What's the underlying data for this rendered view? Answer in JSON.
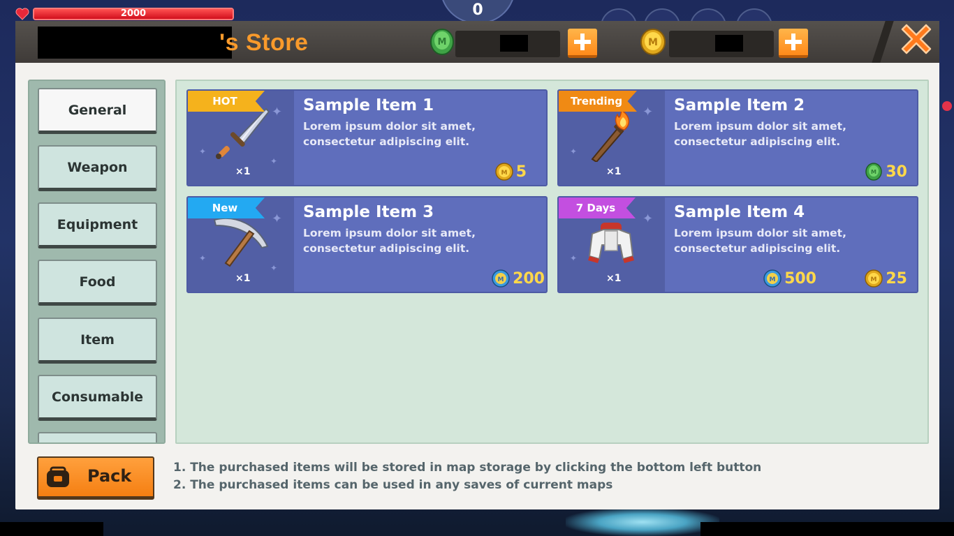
{
  "hud": {
    "hp_value": "2000",
    "hp_fraction": 1.0,
    "dial_value": "0"
  },
  "store": {
    "title_suffix": "'s Store",
    "currency": [
      {
        "name": "gem",
        "icon": "green-gem-icon"
      },
      {
        "name": "coin",
        "icon": "gold-coin-icon"
      }
    ],
    "categories": [
      {
        "label": "General",
        "active": true
      },
      {
        "label": "Weapon",
        "active": false
      },
      {
        "label": "Equipment",
        "active": false
      },
      {
        "label": "Food",
        "active": false
      },
      {
        "label": "Item",
        "active": false
      },
      {
        "label": "Consumable",
        "active": false
      }
    ],
    "items": [
      {
        "badge": "HOT",
        "badge_color": "#f5b21c",
        "name": "Sample Item 1",
        "desc_line1": "Lorem ipsum dolor sit amet,",
        "desc_line2": "consectetur adipiscing elit.",
        "qty": "×1",
        "icon": "sword-icon",
        "prices": [
          {
            "currency": "gold-coin-icon",
            "amount": "5"
          }
        ]
      },
      {
        "badge": "Trending",
        "badge_color": "#f08a14",
        "name": "Sample Item 2",
        "desc_line1": "Lorem ipsum dolor sit amet,",
        "desc_line2": "consectetur adipiscing elit.",
        "qty": "×1",
        "icon": "torch-icon",
        "prices": [
          {
            "currency": "green-gem-icon",
            "amount": "30"
          }
        ]
      },
      {
        "badge": "New",
        "badge_color": "#23a9f2",
        "name": "Sample Item 3",
        "desc_line1": "Lorem ipsum dolor sit amet,",
        "desc_line2": "consectetur adipiscing elit.",
        "qty": "×1",
        "icon": "pickaxe-icon",
        "prices": [
          {
            "currency": "blue-coin-icon",
            "amount": "200"
          }
        ]
      },
      {
        "badge": "7 Days",
        "badge_color": "#c34fe0",
        "name": "Sample Item 4",
        "desc_line1": "Lorem ipsum dolor sit amet,",
        "desc_line2": "consectetur adipiscing elit.",
        "qty": "×1",
        "icon": "jacket-icon",
        "prices": [
          {
            "currency": "blue-coin-icon",
            "amount": "500"
          },
          {
            "currency": "gold-coin-icon",
            "amount": "25"
          }
        ]
      }
    ],
    "pack_label": "Pack",
    "note1": "1. The purchased items will be stored in map storage by clicking the bottom left button",
    "note2": "2. The purchased items can be used in any saves of current maps"
  }
}
